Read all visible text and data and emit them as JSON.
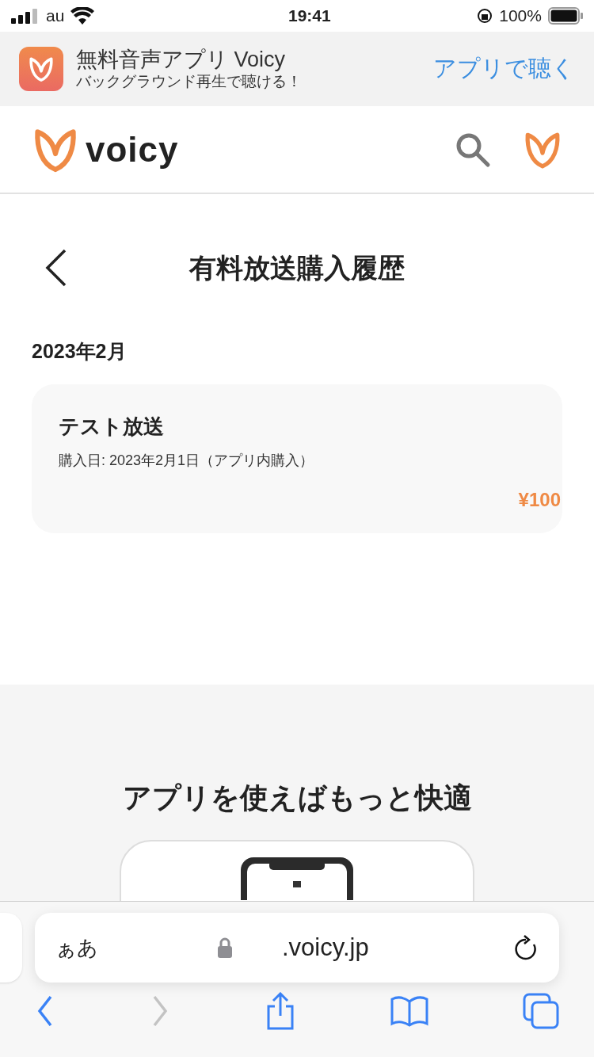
{
  "status_bar": {
    "carrier": "au",
    "time": "19:41",
    "battery": "100%"
  },
  "app_banner": {
    "title": "無料音声アプリ Voicy",
    "subtitle": "バックグラウンド再生で聴ける！",
    "action": "アプリで聴く"
  },
  "header": {
    "logo": "voicy"
  },
  "page": {
    "title": "有料放送購入履歴",
    "sections": [
      {
        "month": "2023年2月",
        "items": [
          {
            "title": "テスト放送",
            "detail": "購入日: 2023年2月1日（アプリ内購入）",
            "price": "¥100"
          }
        ]
      }
    ]
  },
  "promo": {
    "heading": "アプリを使えばもっと快適"
  },
  "browser": {
    "text_size": "ぁあ",
    "url": ".voicy.jp",
    "nav": [
      {
        "kind": "back",
        "disabled": false
      },
      {
        "kind": "forward",
        "disabled": true
      }
    ]
  }
}
